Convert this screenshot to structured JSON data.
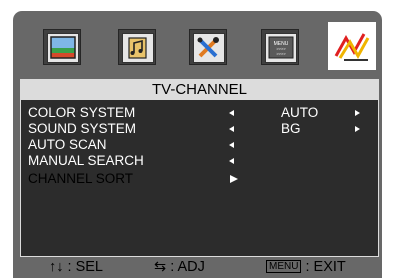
{
  "tabs": [
    {
      "icon": "picture-icon",
      "active": false
    },
    {
      "icon": "audio-icon",
      "active": false
    },
    {
      "icon": "tools-icon",
      "active": false
    },
    {
      "icon": "menu-icon",
      "active": false,
      "label": "MENU\n>>>>\n>>>>"
    },
    {
      "icon": "antenna-icon",
      "active": true
    }
  ],
  "menu": {
    "title": "TV-CHANNEL",
    "items": [
      {
        "label": "COLOR SYSTEM",
        "value": "AUTO"
      },
      {
        "label": "SOUND SYSTEM",
        "value": "BG"
      },
      {
        "label": "AUTO SCAN",
        "value": ""
      },
      {
        "label": "MANUAL SEARCH",
        "value": ""
      },
      {
        "label": "CHANNEL SORT",
        "value": ""
      }
    ]
  },
  "footer": {
    "sel_label": ": SEL",
    "adj_label": ": ADJ",
    "menu_key": "MENU",
    "exit_label": ": EXIT"
  }
}
